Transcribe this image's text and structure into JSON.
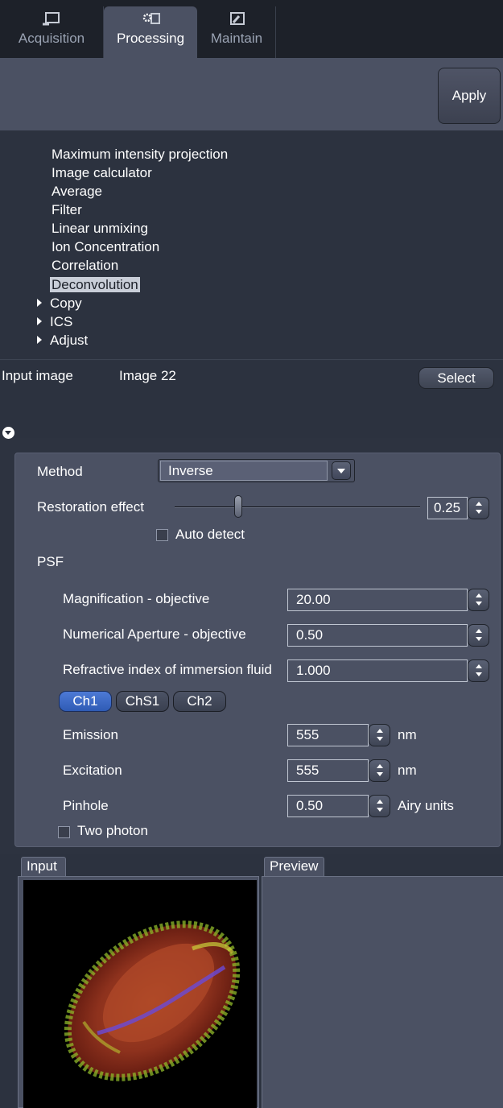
{
  "tabs": [
    {
      "label": "Acquisition",
      "icon": "microscope-icon",
      "active": false
    },
    {
      "label": "Processing",
      "icon": "gear-icon",
      "active": true
    },
    {
      "label": "Maintain",
      "icon": "wrench-icon",
      "active": false
    }
  ],
  "apply_label": "Apply",
  "tool_list": {
    "items": [
      "Maximum intensity projection",
      "Image calculator",
      "Average",
      "Filter",
      "Linear unmixing",
      "Ion Concentration",
      "Correlation",
      "Deconvolution"
    ],
    "selected": "Deconvolution",
    "groups": [
      "Copy",
      "ICS",
      "Adjust"
    ]
  },
  "input": {
    "label": "Input image",
    "image_name": "Image 22",
    "select_label": "Select"
  },
  "method": {
    "label": "Method",
    "value": "Inverse"
  },
  "restoration": {
    "label": "Restoration effect",
    "value": "0.25",
    "slider_fraction": 0.25
  },
  "auto_detect_label": "Auto detect",
  "psf": {
    "label": "PSF",
    "magnification": {
      "label": "Magnification - objective",
      "value": "20.00"
    },
    "numerical_aperture": {
      "label": "Numerical Aperture - objective",
      "value": "0.50"
    },
    "refractive_index": {
      "label": "Refractive index of immersion fluid",
      "value": "1.000"
    },
    "channels": [
      "Ch1",
      "ChS1",
      "Ch2"
    ],
    "active_channel": "Ch1",
    "emission": {
      "label": "Emission",
      "value": "555",
      "unit": "nm"
    },
    "excitation": {
      "label": "Excitation",
      "value": "555",
      "unit": "nm"
    },
    "pinhole": {
      "label": "Pinhole",
      "value": "0.50",
      "unit": "Airy units"
    },
    "two_photon_label": "Two photon"
  },
  "panels": {
    "input_tab": "Input",
    "preview_tab": "Preview"
  },
  "colors": {
    "accent": "#3f6cc9",
    "panel": "#4b5163",
    "background": "#2c323f"
  }
}
